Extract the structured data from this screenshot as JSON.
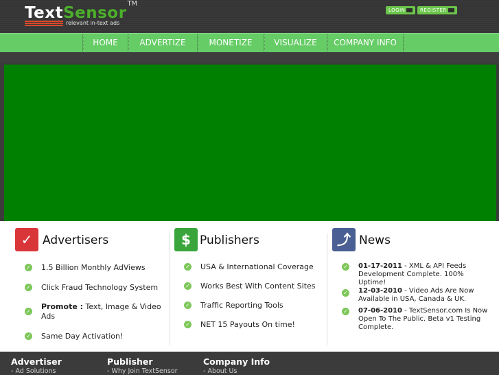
{
  "header": {
    "logo_text_1": "Text",
    "logo_text_2": "Sensor",
    "logo_tm": "TM",
    "tagline": "relevant in-text ads",
    "login_label": "LOGIN",
    "register_label": "REGISTER"
  },
  "nav": {
    "items": [
      "HOME",
      "ADVERTIZE",
      "MONETIZE",
      "VISUALIZE",
      "COMPANY INFO"
    ]
  },
  "advertisers": {
    "title": "Advertisers",
    "icon": "checkmark-icon",
    "items": [
      {
        "text": "1.5 Billion Monthly AdViews"
      },
      {
        "text": "Click Fraud Technology System"
      },
      {
        "bold": "Promote :",
        "text": " Text, Image & Video Ads"
      },
      {
        "text": "Same Day Activation!"
      }
    ]
  },
  "publishers": {
    "title": "Publishers",
    "icon": "dollar-icon",
    "items": [
      {
        "text": "USA & International Coverage"
      },
      {
        "text": "Works Best With Content Sites"
      },
      {
        "text": "Traffic Reporting Tools"
      },
      {
        "text": "NET 15 Payouts On time!"
      }
    ]
  },
  "news": {
    "title": "News",
    "icon": "arrow-up-icon",
    "items": [
      {
        "date": "01-17-2011",
        "text": " - XML & API Feeds Development Complete. 100% Uptime!"
      },
      {
        "date": "12-03-2010",
        "text": " - Video Ads Are Now Available in USA, Canada & UK."
      },
      {
        "date": "07-06-2010",
        "text": " - TextSensor.com Is Now Open To The Public. Beta v1 Testing Complete."
      }
    ]
  },
  "footer": {
    "advertiser_heading": "Advertiser",
    "advertiser_link": "- Ad Solutions",
    "publisher_heading": "Publisher",
    "publisher_link": "- Why Join TextSensor",
    "company_heading": "Company Info",
    "company_link": "- About Us"
  },
  "colors": {
    "nav_green": "#66cc66",
    "banner_green": "#008000",
    "brand_green": "#4caf2a",
    "accent_red": "#d9482b"
  }
}
